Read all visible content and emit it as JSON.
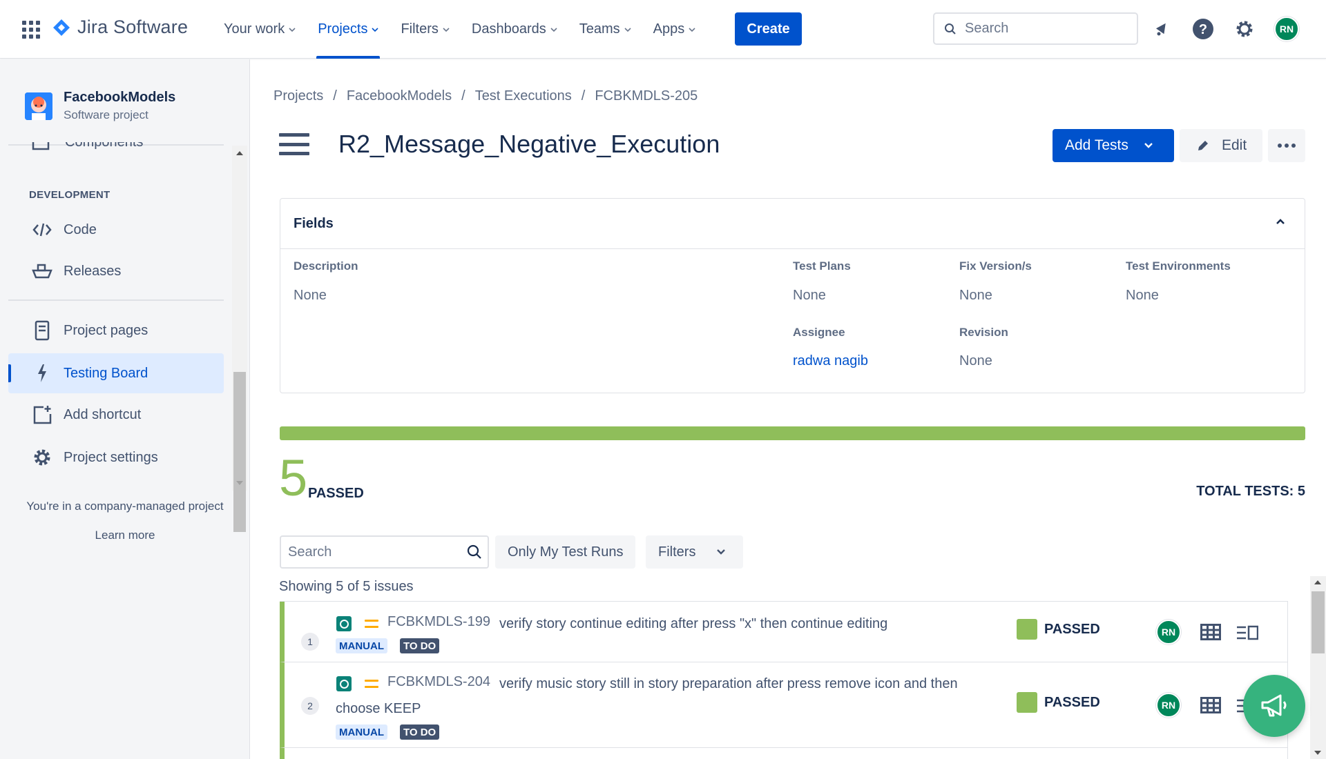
{
  "topnav": {
    "logo_text": "Jira Software",
    "items": [
      {
        "label": "Your work"
      },
      {
        "label": "Projects"
      },
      {
        "label": "Filters"
      },
      {
        "label": "Dashboards"
      },
      {
        "label": "Teams"
      },
      {
        "label": "Apps"
      }
    ],
    "active_item": "Projects",
    "create_label": "Create",
    "search_placeholder": "Search",
    "user_initials": "RN",
    "accent_color": "#0052cc"
  },
  "sidebar": {
    "project_name": "FacebookModels",
    "project_type": "Software project",
    "partial_item": "Components",
    "section_title": "DEVELOPMENT",
    "dev_items": [
      {
        "label": "Code",
        "icon": "code-icon"
      },
      {
        "label": "Releases",
        "icon": "ship-icon"
      }
    ],
    "items": [
      {
        "label": "Project pages",
        "icon": "page-icon"
      },
      {
        "label": "Testing Board",
        "icon": "lightning-icon",
        "active": true
      },
      {
        "label": "Add shortcut",
        "icon": "add-shortcut-icon"
      },
      {
        "label": "Project settings",
        "icon": "gear-icon"
      }
    ],
    "footer_text": "You're in a company-managed project",
    "learn_more": "Learn more"
  },
  "breadcrumb": [
    "Projects",
    "FacebookModels",
    "Test Executions",
    "FCBKMDLS-205"
  ],
  "page": {
    "title": "R2_Message_Negative_Execution",
    "add_tests_label": "Add Tests",
    "edit_label": "Edit"
  },
  "fields": {
    "header": "Fields",
    "description_label": "Description",
    "description_value": "None",
    "test_plans_label": "Test Plans",
    "test_plans_value": "None",
    "fix_version_label": "Fix Version/s",
    "fix_version_value": "None",
    "test_env_label": "Test Environments",
    "test_env_value": "None",
    "assignee_label": "Assignee",
    "assignee_value": "radwa nagib",
    "revision_label": "Revision",
    "revision_value": "None"
  },
  "summary": {
    "passed_count": "5",
    "passed_label": "PASSED",
    "total_tests": "TOTAL TESTS: 5",
    "progress_passed_fraction": 1.0,
    "passed_color": "#8fbe5a"
  },
  "toolbar": {
    "search_placeholder": "Search",
    "only_my_runs": "Only My Test Runs",
    "filters": "Filters",
    "showing": "Showing 5 of 5 issues"
  },
  "issues": [
    {
      "index": "1",
      "key": "FCBKMDLS-199",
      "summary_line1": "verify story continue editing after press \"x\" then continue editing",
      "summary_line2": "",
      "type_tag": "MANUAL",
      "status_tag": "TO DO",
      "result": "PASSED",
      "assignee_initials": "RN"
    },
    {
      "index": "2",
      "key": "FCBKMDLS-204",
      "summary_line1": "verify music story still in story preparation after press remove icon and then",
      "summary_line2": "choose KEEP",
      "type_tag": "MANUAL",
      "status_tag": "TO DO",
      "result": "PASSED",
      "assignee_initials": "RN"
    }
  ]
}
